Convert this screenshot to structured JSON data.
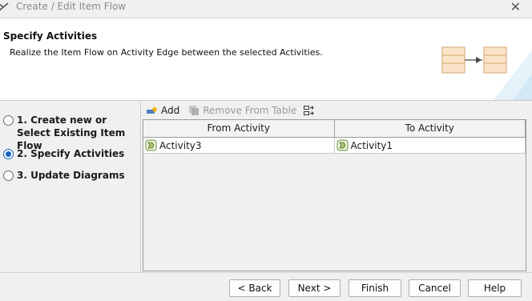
{
  "window": {
    "title": "Create / Edit Item Flow",
    "close_glyph": "✕"
  },
  "banner": {
    "heading": "Specify Activities",
    "description": "Realize the Item Flow on Activity Edge between the selected Activities."
  },
  "steps": [
    {
      "label": "1. Create new or\nSelect Existing Item Flow",
      "selected": false
    },
    {
      "label": "2. Specify Activities",
      "selected": true
    },
    {
      "label": "3. Update Diagrams",
      "selected": false
    }
  ],
  "toolbar": {
    "add_label": "Add",
    "remove_label": "Remove From Table",
    "add_icon": "add-icon",
    "remove_icon": "remove-icon",
    "extra_icon": "table-options-icon"
  },
  "table": {
    "columns": [
      "From Activity",
      "To Activity"
    ],
    "rows": [
      {
        "from": "Activity3",
        "to": "Activity1"
      }
    ]
  },
  "buttons": {
    "back": "< Back",
    "next": "Next >",
    "finish": "Finish",
    "cancel": "Cancel",
    "help": "Help"
  }
}
